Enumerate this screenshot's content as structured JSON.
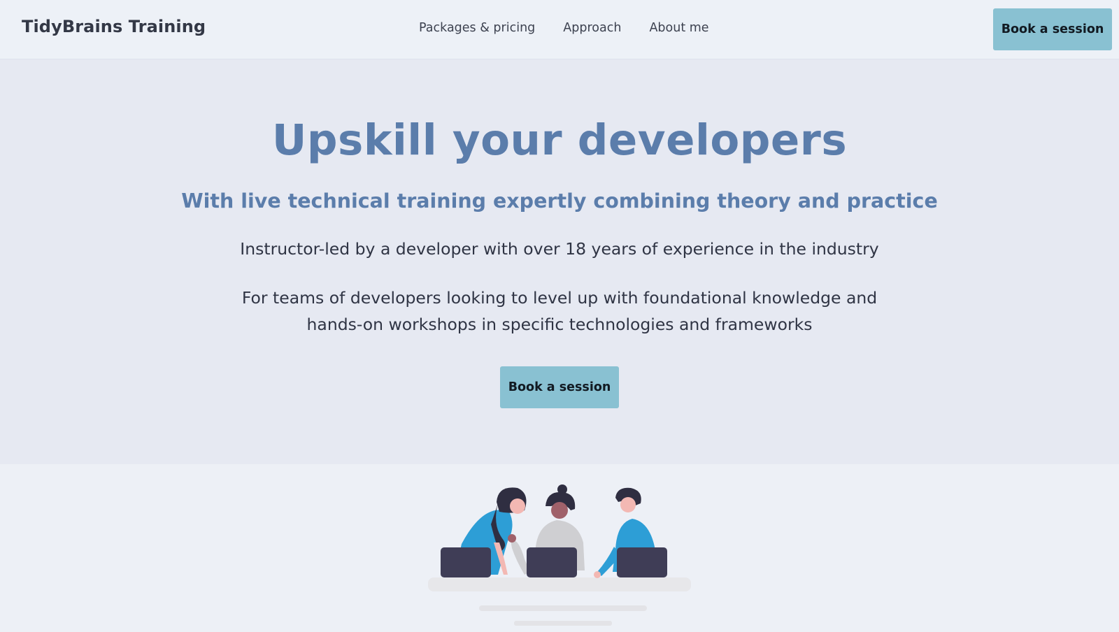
{
  "navbar": {
    "brand": "TidyBrains Training",
    "links": [
      "Packages & pricing",
      "Approach",
      "About me"
    ],
    "cta_label": "Book a session"
  },
  "hero": {
    "title": "Upskill your developers",
    "subtitle": "With live technical training expertly combining theory and practice",
    "line1": "Instructor-led by a developer with over 18 years of experience in the industry",
    "line2": "For teams of developers looking to level up with foundational knowledge and hands-on workshops in specific technologies and frameworks",
    "cta_label": "Book a session"
  },
  "illustration": {
    "icon": "team-working-at-laptops-illustration"
  },
  "colors": {
    "accent_button": "#89c1d2",
    "heading_blue": "#5b7dab",
    "hero_bg": "#e6e9f2",
    "nav_bg": "#edf1f7"
  }
}
